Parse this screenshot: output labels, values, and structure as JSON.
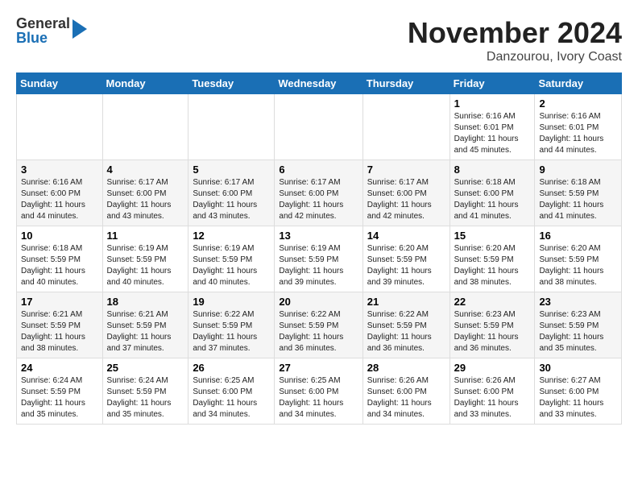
{
  "logo": {
    "general": "General",
    "blue": "Blue"
  },
  "header": {
    "month": "November 2024",
    "location": "Danzourou, Ivory Coast"
  },
  "weekdays": [
    "Sunday",
    "Monday",
    "Tuesday",
    "Wednesday",
    "Thursday",
    "Friday",
    "Saturday"
  ],
  "weeks": [
    [
      {
        "day": "",
        "info": ""
      },
      {
        "day": "",
        "info": ""
      },
      {
        "day": "",
        "info": ""
      },
      {
        "day": "",
        "info": ""
      },
      {
        "day": "",
        "info": ""
      },
      {
        "day": "1",
        "info": "Sunrise: 6:16 AM\nSunset: 6:01 PM\nDaylight: 11 hours\nand 45 minutes."
      },
      {
        "day": "2",
        "info": "Sunrise: 6:16 AM\nSunset: 6:01 PM\nDaylight: 11 hours\nand 44 minutes."
      }
    ],
    [
      {
        "day": "3",
        "info": "Sunrise: 6:16 AM\nSunset: 6:00 PM\nDaylight: 11 hours\nand 44 minutes."
      },
      {
        "day": "4",
        "info": "Sunrise: 6:17 AM\nSunset: 6:00 PM\nDaylight: 11 hours\nand 43 minutes."
      },
      {
        "day": "5",
        "info": "Sunrise: 6:17 AM\nSunset: 6:00 PM\nDaylight: 11 hours\nand 43 minutes."
      },
      {
        "day": "6",
        "info": "Sunrise: 6:17 AM\nSunset: 6:00 PM\nDaylight: 11 hours\nand 42 minutes."
      },
      {
        "day": "7",
        "info": "Sunrise: 6:17 AM\nSunset: 6:00 PM\nDaylight: 11 hours\nand 42 minutes."
      },
      {
        "day": "8",
        "info": "Sunrise: 6:18 AM\nSunset: 6:00 PM\nDaylight: 11 hours\nand 41 minutes."
      },
      {
        "day": "9",
        "info": "Sunrise: 6:18 AM\nSunset: 5:59 PM\nDaylight: 11 hours\nand 41 minutes."
      }
    ],
    [
      {
        "day": "10",
        "info": "Sunrise: 6:18 AM\nSunset: 5:59 PM\nDaylight: 11 hours\nand 40 minutes."
      },
      {
        "day": "11",
        "info": "Sunrise: 6:19 AM\nSunset: 5:59 PM\nDaylight: 11 hours\nand 40 minutes."
      },
      {
        "day": "12",
        "info": "Sunrise: 6:19 AM\nSunset: 5:59 PM\nDaylight: 11 hours\nand 40 minutes."
      },
      {
        "day": "13",
        "info": "Sunrise: 6:19 AM\nSunset: 5:59 PM\nDaylight: 11 hours\nand 39 minutes."
      },
      {
        "day": "14",
        "info": "Sunrise: 6:20 AM\nSunset: 5:59 PM\nDaylight: 11 hours\nand 39 minutes."
      },
      {
        "day": "15",
        "info": "Sunrise: 6:20 AM\nSunset: 5:59 PM\nDaylight: 11 hours\nand 38 minutes."
      },
      {
        "day": "16",
        "info": "Sunrise: 6:20 AM\nSunset: 5:59 PM\nDaylight: 11 hours\nand 38 minutes."
      }
    ],
    [
      {
        "day": "17",
        "info": "Sunrise: 6:21 AM\nSunset: 5:59 PM\nDaylight: 11 hours\nand 38 minutes."
      },
      {
        "day": "18",
        "info": "Sunrise: 6:21 AM\nSunset: 5:59 PM\nDaylight: 11 hours\nand 37 minutes."
      },
      {
        "day": "19",
        "info": "Sunrise: 6:22 AM\nSunset: 5:59 PM\nDaylight: 11 hours\nand 37 minutes."
      },
      {
        "day": "20",
        "info": "Sunrise: 6:22 AM\nSunset: 5:59 PM\nDaylight: 11 hours\nand 36 minutes."
      },
      {
        "day": "21",
        "info": "Sunrise: 6:22 AM\nSunset: 5:59 PM\nDaylight: 11 hours\nand 36 minutes."
      },
      {
        "day": "22",
        "info": "Sunrise: 6:23 AM\nSunset: 5:59 PM\nDaylight: 11 hours\nand 36 minutes."
      },
      {
        "day": "23",
        "info": "Sunrise: 6:23 AM\nSunset: 5:59 PM\nDaylight: 11 hours\nand 35 minutes."
      }
    ],
    [
      {
        "day": "24",
        "info": "Sunrise: 6:24 AM\nSunset: 5:59 PM\nDaylight: 11 hours\nand 35 minutes."
      },
      {
        "day": "25",
        "info": "Sunrise: 6:24 AM\nSunset: 5:59 PM\nDaylight: 11 hours\nand 35 minutes."
      },
      {
        "day": "26",
        "info": "Sunrise: 6:25 AM\nSunset: 6:00 PM\nDaylight: 11 hours\nand 34 minutes."
      },
      {
        "day": "27",
        "info": "Sunrise: 6:25 AM\nSunset: 6:00 PM\nDaylight: 11 hours\nand 34 minutes."
      },
      {
        "day": "28",
        "info": "Sunrise: 6:26 AM\nSunset: 6:00 PM\nDaylight: 11 hours\nand 34 minutes."
      },
      {
        "day": "29",
        "info": "Sunrise: 6:26 AM\nSunset: 6:00 PM\nDaylight: 11 hours\nand 33 minutes."
      },
      {
        "day": "30",
        "info": "Sunrise: 6:27 AM\nSunset: 6:00 PM\nDaylight: 11 hours\nand 33 minutes."
      }
    ]
  ]
}
